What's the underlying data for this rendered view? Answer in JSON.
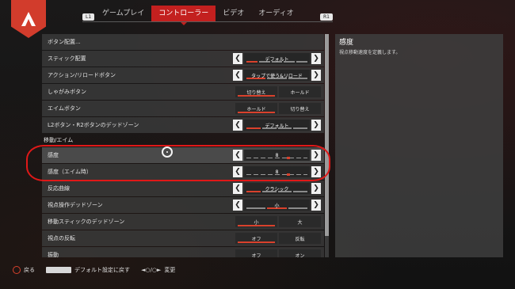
{
  "tabs": {
    "left_bumper": "L1",
    "right_bumper": "R1",
    "items": [
      "ゲームプレイ",
      "コントローラー",
      "ビデオ",
      "オーディオ"
    ]
  },
  "list": {
    "rows_top": [
      {
        "label": "ボタン配置..."
      },
      {
        "label": "スティック配置",
        "value": "デフォルト"
      },
      {
        "label": "アクション/リロードボタン",
        "value": "タップで使う&リロード"
      },
      {
        "label": "しゃがみボタン",
        "option_a": "切り替え",
        "option_b": "ホールド",
        "selected": "a"
      },
      {
        "label": "エイムボタン",
        "option_a": "ホールド",
        "option_b": "切り替え",
        "selected": "a"
      },
      {
        "label": "L2ボタン・R2ボタンのデッドゾーン",
        "value": "デフォルト"
      }
    ],
    "section_title": "移動/エイム",
    "rows_bottom": [
      {
        "label": "感度",
        "value": "8",
        "level": 0.7
      },
      {
        "label": "感度（エイム時）",
        "value": "8",
        "level": 0.7
      },
      {
        "label": "反応曲線",
        "value": "クラシック"
      },
      {
        "label": "視点操作デッドゾーン",
        "value": "小"
      },
      {
        "label": "移動スティックのデッドゾーン",
        "option_a": "小",
        "option_b": "大",
        "selected": "a"
      },
      {
        "label": "視点の反転",
        "option_a": "オフ",
        "option_b": "反転",
        "selected": "a"
      },
      {
        "label": "振動",
        "option_a": "オフ",
        "option_b": "オン",
        "selected": "b"
      }
    ]
  },
  "description": {
    "title": "感度",
    "text": "視点移動速度を定義します。"
  },
  "footer": {
    "back": "戻る",
    "reset": "デフォルト設定に戻す",
    "change": "変更"
  },
  "colors": {
    "accent": "#c3201f",
    "annotation": "#e01818"
  },
  "icons": {
    "logo": "apex-logo-icon",
    "back": "circle-button-icon",
    "reset": "touchpad-icon",
    "change": "dpad-icon"
  }
}
